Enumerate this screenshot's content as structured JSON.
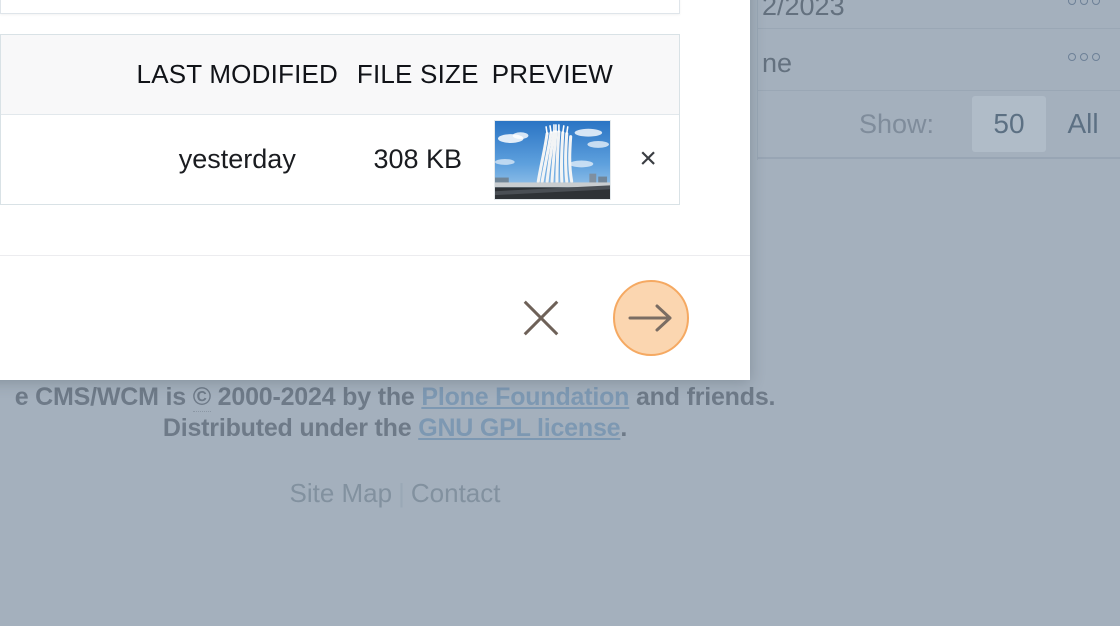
{
  "overlay": {
    "dim_color": "#a4b0bd"
  },
  "background_page": {
    "listing": {
      "row_date": "2/2023",
      "row_name": "ne",
      "menu_icon": "more-actions-dots-icon"
    },
    "pagination": {
      "show_label": "Show:",
      "options": [
        "50",
        "All"
      ],
      "selected": "50"
    }
  },
  "footer": {
    "line1_a": "e CMS/WCM is ",
    "copyright_symbol": "©",
    "line1_b": " 2000-2024 by the ",
    "plone_link": "Plone Foundation",
    "line1_c": " and friends.",
    "line2_a": "Distributed under the ",
    "gpl_link": "GNU GPL license",
    "line2_b": ".",
    "site_map": "Site Map",
    "separator": "|",
    "contact": "Contact",
    "link_color": "#7d98b2",
    "text_color": "#6e7a88"
  },
  "modal": {
    "table": {
      "headers": [
        "",
        "LAST MODIFIED",
        "FILE SIZE",
        "PREVIEW",
        ""
      ],
      "rows": [
        {
          "name": "",
          "last_modified": "yesterday",
          "file_size": "308 KB",
          "preview_alt": "brasilia-cathedral-thumbnail",
          "remove_label": "×"
        }
      ]
    },
    "actions": {
      "cancel_icon": "close-x-icon",
      "next_icon": "arrow-right-icon",
      "next_button_fill": "#fbd6b0",
      "next_button_border": "#f5a962"
    }
  }
}
